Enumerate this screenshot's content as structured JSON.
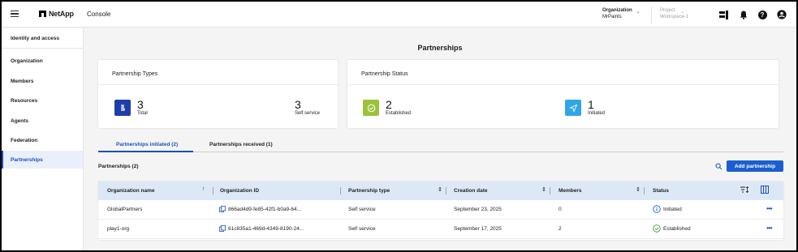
{
  "header": {
    "brand": "NetApp",
    "app_name": "Console",
    "org_label": "Organization",
    "org_value": "MrPaints",
    "project_label": "Project",
    "project_value": "Workspace-1"
  },
  "sidebar": {
    "items": [
      {
        "label": "Identity and access"
      },
      {
        "label": "Organization"
      },
      {
        "label": "Members"
      },
      {
        "label": "Resources"
      },
      {
        "label": "Agents"
      },
      {
        "label": "Federation"
      },
      {
        "label": "Partnerships",
        "active": true
      }
    ]
  },
  "page": {
    "title": "Partnerships"
  },
  "types_card": {
    "title": "Partnership Types",
    "total_value": "3",
    "total_label": "Total",
    "self_value": "3",
    "self_label": "Self service"
  },
  "status_card": {
    "title": "Partnership Status",
    "established_value": "2",
    "established_label": "Established",
    "initiated_value": "1",
    "initiated_label": "Initiated"
  },
  "tabs": [
    {
      "label": "Partnerships initiated (2)",
      "active": true
    },
    {
      "label": "Partnerships received (1)"
    }
  ],
  "table": {
    "title": "Partnerships (2)",
    "add_button": "Add partnership",
    "columns": [
      "Organization name",
      "Organization ID",
      "Partnership type",
      "Creation date",
      "Members",
      "Status"
    ],
    "rows": [
      {
        "name": "GlobalPartners",
        "org_id": "866ad4d9-fe85-42f1-b0a9-64...",
        "type": "Self service",
        "date": "September 23, 2025",
        "members": "0",
        "status": "Initiated"
      },
      {
        "name": "play1-org",
        "org_id": "61c835a1-469d-4349-8190-24...",
        "type": "Self service",
        "date": "September 17, 2025",
        "members": "2",
        "status": "Established"
      }
    ]
  },
  "colors": {
    "accent": "#1a5fd0",
    "types_icon": "#1f3fa8",
    "established_icon": "#9cc23a",
    "initiated_icon": "#2fa6e6",
    "header_row": "#dde8f7"
  },
  "icons": [
    "hamburger-icon",
    "netapp-logo",
    "chevron-down-icon",
    "grid-icon",
    "bell-icon",
    "help-icon",
    "user-icon",
    "search-icon",
    "copy-icon",
    "info-icon",
    "check-circle-icon",
    "sort-icon",
    "filter-icon",
    "columns-icon",
    "more-icon"
  ]
}
